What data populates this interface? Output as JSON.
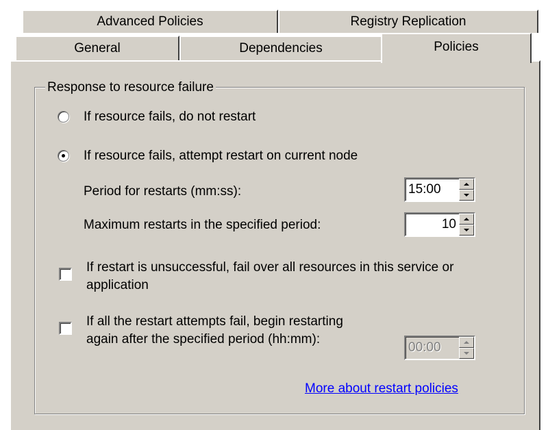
{
  "tabs": {
    "row_back": [
      "Advanced Policies",
      "Registry Replication"
    ],
    "row_front": [
      "General",
      "Dependencies"
    ],
    "selected": "Policies"
  },
  "group": {
    "legend": "Response to resource failure"
  },
  "options": {
    "no_restart": {
      "label": "If resource fails, do not restart",
      "selected": false
    },
    "attempt_restart": {
      "label": "If resource fails, attempt restart on current node",
      "selected": true
    }
  },
  "fields": {
    "period": {
      "label": "Period for restarts (mm:ss):",
      "value": "15:00"
    },
    "max_restarts": {
      "label": "Maximum restarts in the specified period:",
      "value": "10"
    }
  },
  "checkboxes": {
    "failover": {
      "line1": "If restart is unsuccessful, fail over all resources in this service or",
      "line2": "application",
      "checked": false
    },
    "restart_again": {
      "line1": "If all the restart attempts fail, begin restarting",
      "line2": "again after the specified period (hh:mm):",
      "checked": false,
      "value": "00:00"
    }
  },
  "link": {
    "label": "More about restart policies"
  },
  "colors": {
    "face": "#d4d0c8",
    "link": "#0000ff"
  },
  "icons": [
    "radio-unselected-icon",
    "radio-selected-icon",
    "checkbox-icon",
    "spin-up-icon",
    "spin-down-icon"
  ]
}
